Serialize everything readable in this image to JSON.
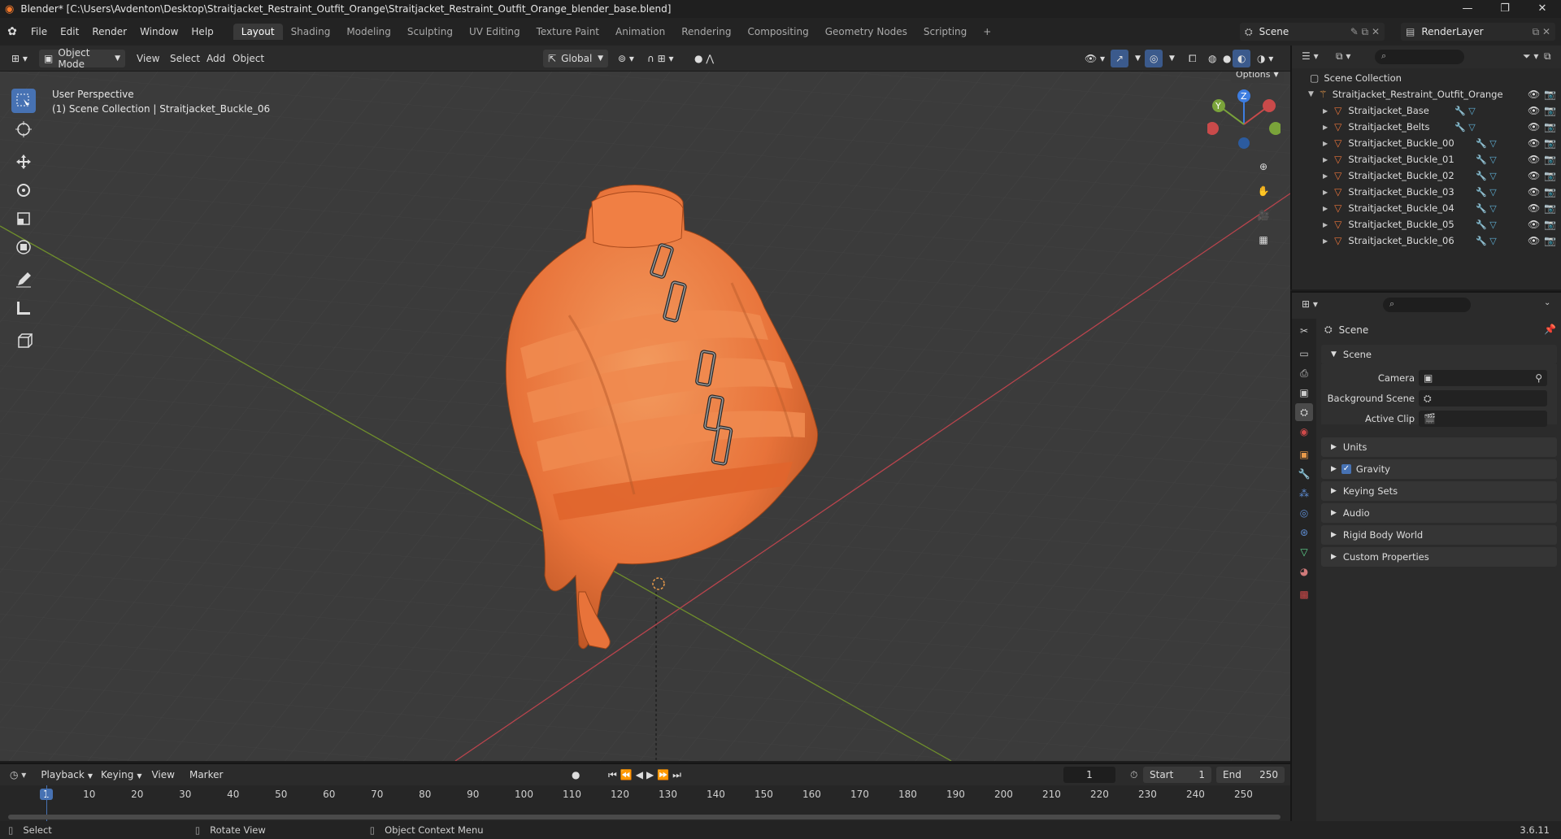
{
  "window": {
    "title": "Blender* [C:\\Users\\Avdenton\\Desktop\\Straitjacket_Restraint_Outfit_Orange\\Straitjacket_Restraint_Outfit_Orange_blender_base.blend]",
    "minimize": "—",
    "maximize": "❐",
    "close": "✕"
  },
  "menu": [
    "File",
    "Edit",
    "Render",
    "Window",
    "Help"
  ],
  "workspaces": [
    "Layout",
    "Shading",
    "Modeling",
    "Sculpting",
    "UV Editing",
    "Texture Paint",
    "Animation",
    "Rendering",
    "Compositing",
    "Geometry Nodes",
    "Scripting"
  ],
  "active_workspace": "Layout",
  "add_workspace": "+",
  "scene_name": "Scene",
  "render_layer": "RenderLayer",
  "viewport_header": {
    "mode": "Object Mode",
    "menus": [
      "View",
      "Select",
      "Add",
      "Object"
    ],
    "orientation": "Global",
    "options": "Options"
  },
  "viewport": {
    "perspective": "User Perspective",
    "collection_info": "(1) Scene Collection | Straitjacket_Buckle_06",
    "gizmo": {
      "x": "X",
      "y": "Y",
      "z": "Z"
    }
  },
  "outliner": {
    "root": "Scene Collection",
    "collection": "Straitjacket_Restraint_Outfit_Orange",
    "objects": [
      "Straitjacket_Base",
      "Straitjacket_Belts",
      "Straitjacket_Buckle_00",
      "Straitjacket_Buckle_01",
      "Straitjacket_Buckle_02",
      "Straitjacket_Buckle_03",
      "Straitjacket_Buckle_04",
      "Straitjacket_Buckle_05",
      "Straitjacket_Buckle_06"
    ]
  },
  "properties": {
    "context": "Scene",
    "panel": "Scene",
    "fields": {
      "camera": "Camera",
      "background_scene": "Background Scene",
      "active_clip": "Active Clip"
    },
    "subpanels": [
      "Units",
      "Gravity",
      "Keying Sets",
      "Audio",
      "Rigid Body World",
      "Custom Properties"
    ],
    "gravity_checked": true
  },
  "timeline": {
    "menus": [
      "Playback",
      "Keying",
      "View",
      "Marker"
    ],
    "current_frame": "1",
    "start_label": "Start",
    "start": "1",
    "end_label": "End",
    "end": "250",
    "ruler": [
      "1",
      "10",
      "20",
      "30",
      "40",
      "50",
      "60",
      "70",
      "80",
      "90",
      "100",
      "110",
      "120",
      "130",
      "140",
      "150",
      "160",
      "170",
      "180",
      "190",
      "200",
      "210",
      "220",
      "230",
      "240",
      "250"
    ]
  },
  "statusbar": {
    "select": "Select",
    "rotate": "Rotate View",
    "context_menu": "Object Context Menu",
    "version": "3.6.11"
  },
  "colors": {
    "accent": "#4772b3",
    "jacket": "#e8733a",
    "x_axis": "#c94a4a",
    "y_axis": "#7aa33a",
    "z_axis": "#3d7de0"
  }
}
